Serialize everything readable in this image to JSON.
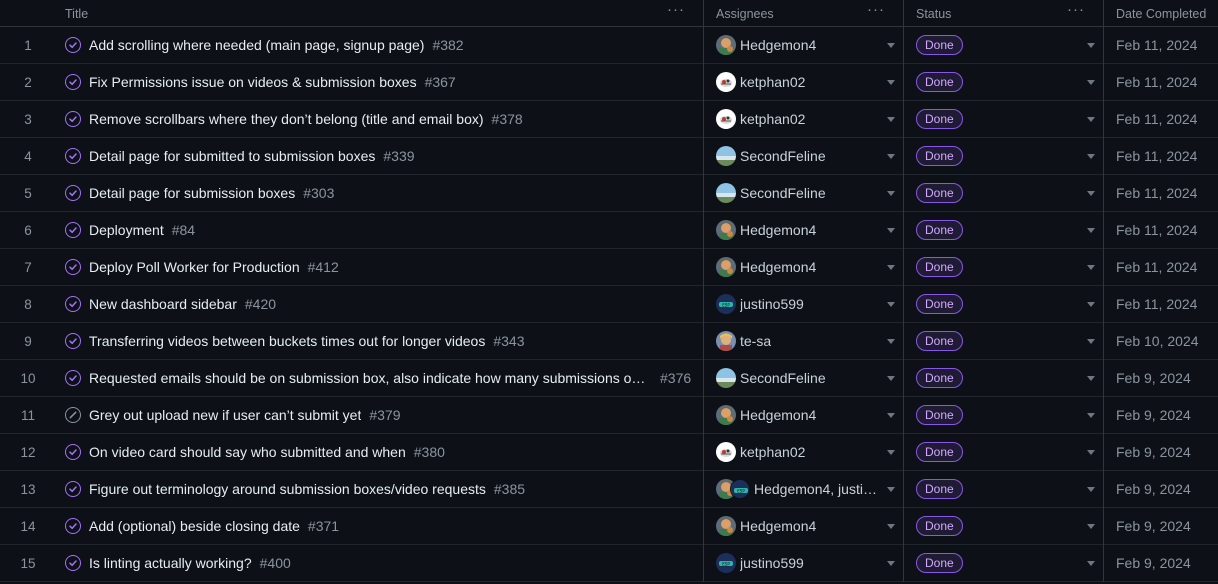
{
  "columns": {
    "title": "Title",
    "assignees": "Assignees",
    "status": "Status",
    "date_completed": "Date Completed",
    "menu_dots": "···"
  },
  "colors": {
    "done_purple": "#a371f7",
    "badge_text": "#d2a8ff",
    "background": "#0d1117"
  },
  "rows": [
    {
      "num": "1",
      "state": "completed",
      "title": "Add scrolling where needed (main page, signup page)",
      "issue": "#382",
      "assignee": "Hedgemon4",
      "avatar": "avatar-hedgemon4",
      "status": "Done",
      "date": "Feb 11, 2024"
    },
    {
      "num": "2",
      "state": "completed",
      "title": "Fix Permissions issue on videos & submission boxes",
      "issue": "#367",
      "assignee": "ketphan02",
      "avatar": "avatar-ketphan02",
      "status": "Done",
      "date": "Feb 11, 2024"
    },
    {
      "num": "3",
      "state": "completed",
      "title": "Remove scrollbars where they don’t belong (title and email box)",
      "issue": "#378",
      "assignee": "ketphan02",
      "avatar": "avatar-ketphan02",
      "status": "Done",
      "date": "Feb 11, 2024"
    },
    {
      "num": "4",
      "state": "completed",
      "title": "Detail page for submitted to submission boxes",
      "issue": "#339",
      "assignee": "SecondFeline",
      "avatar": "avatar-secondfeline",
      "status": "Done",
      "date": "Feb 11, 2024"
    },
    {
      "num": "5",
      "state": "completed",
      "title": "Detail page for submission boxes",
      "issue": "#303",
      "assignee": "SecondFeline",
      "avatar": "avatar-secondfeline",
      "status": "Done",
      "date": "Feb 11, 2024"
    },
    {
      "num": "6",
      "state": "completed",
      "title": "Deployment",
      "issue": "#84",
      "assignee": "Hedgemon4",
      "avatar": "avatar-hedgemon4",
      "status": "Done",
      "date": "Feb 11, 2024"
    },
    {
      "num": "7",
      "state": "completed",
      "title": "Deploy Poll Worker for Production",
      "issue": "#412",
      "assignee": "Hedgemon4",
      "avatar": "avatar-hedgemon4",
      "status": "Done",
      "date": "Feb 11, 2024"
    },
    {
      "num": "8",
      "state": "completed",
      "title": "New dashboard sidebar",
      "issue": "#420",
      "assignee": "justino599",
      "avatar": "avatar-justino599",
      "status": "Done",
      "date": "Feb 11, 2024"
    },
    {
      "num": "9",
      "state": "completed",
      "title": "Transferring videos between buckets times out for longer videos",
      "issue": "#343",
      "assignee": "te-sa",
      "avatar": "avatar-te-sa",
      "status": "Done",
      "date": "Feb 10, 2024"
    },
    {
      "num": "10",
      "state": "completed",
      "title": "Requested emails should be on submission box, also indicate how many submissions out of how many requested",
      "issue": "#376",
      "assignee": "SecondFeline",
      "avatar": "avatar-secondfeline",
      "status": "Done",
      "date": "Feb 9, 2024"
    },
    {
      "num": "11",
      "state": "not-planned",
      "title": "Grey out upload new if user can’t submit yet",
      "issue": "#379",
      "assignee": "Hedgemon4",
      "avatar": "avatar-hedgemon4",
      "status": "Done",
      "date": "Feb 9, 2024"
    },
    {
      "num": "12",
      "state": "completed",
      "title": "On video card should say who submitted and when",
      "issue": "#380",
      "assignee": "ketphan02",
      "avatar": "avatar-ketphan02",
      "status": "Done",
      "date": "Feb 9, 2024"
    },
    {
      "num": "13",
      "state": "completed",
      "title": "Figure out terminology around submission boxes/video requests",
      "issue": "#385",
      "assignee": "Hedgemon4, justin…",
      "avatar": "avatar-hedgemon4",
      "avatar2": "avatar-justino599",
      "status": "Done",
      "date": "Feb 9, 2024"
    },
    {
      "num": "14",
      "state": "completed",
      "title": "Add (optional) beside closing date",
      "issue": "#371",
      "assignee": "Hedgemon4",
      "avatar": "avatar-hedgemon4",
      "status": "Done",
      "date": "Feb 9, 2024"
    },
    {
      "num": "15",
      "state": "completed",
      "title": "Is linting actually working?",
      "issue": "#400",
      "assignee": "justino599",
      "avatar": "avatar-justino599",
      "status": "Done",
      "date": "Feb 9, 2024"
    }
  ]
}
